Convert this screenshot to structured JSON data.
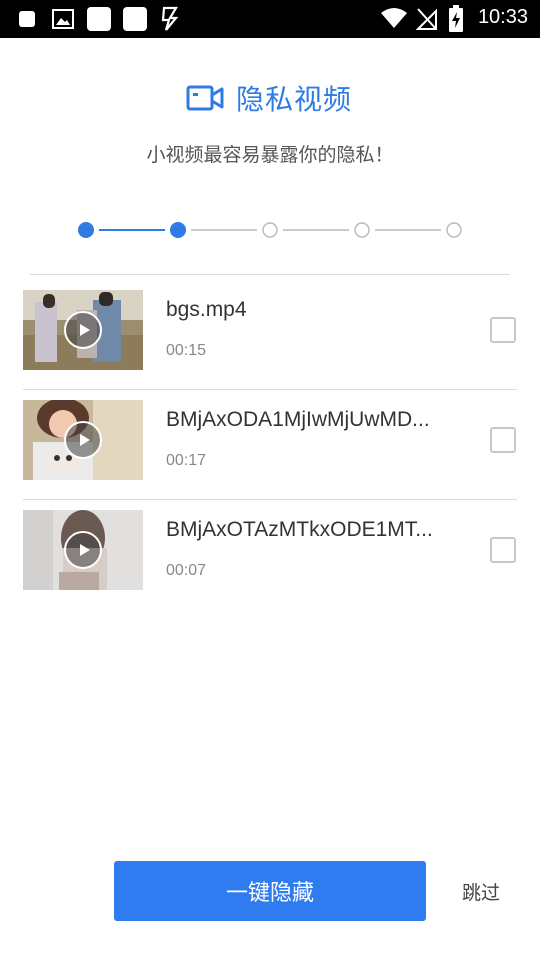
{
  "status_bar": {
    "time": "10:33"
  },
  "header": {
    "title": "隐私视频",
    "icon": "video-camera-icon"
  },
  "subtitle": "小视频最容易暴露你的隐私！",
  "stepper": {
    "total_steps": 5,
    "completed_steps": 2,
    "active_color": "#2f7be5",
    "inactive_color": "#bbbbbb"
  },
  "videos": [
    {
      "name": "bgs.mp4",
      "duration": "00:15",
      "checked": false
    },
    {
      "name": "BMjAxODA1MjIwMjUwMD...",
      "duration": "00:17",
      "checked": false
    },
    {
      "name": "BMjAxOTAzMTkxODE1MT...",
      "duration": "00:07",
      "checked": false
    }
  ],
  "actions": {
    "primary": "一键隐藏",
    "skip": "跳过"
  },
  "colors": {
    "accent": "#2e7cf0"
  }
}
